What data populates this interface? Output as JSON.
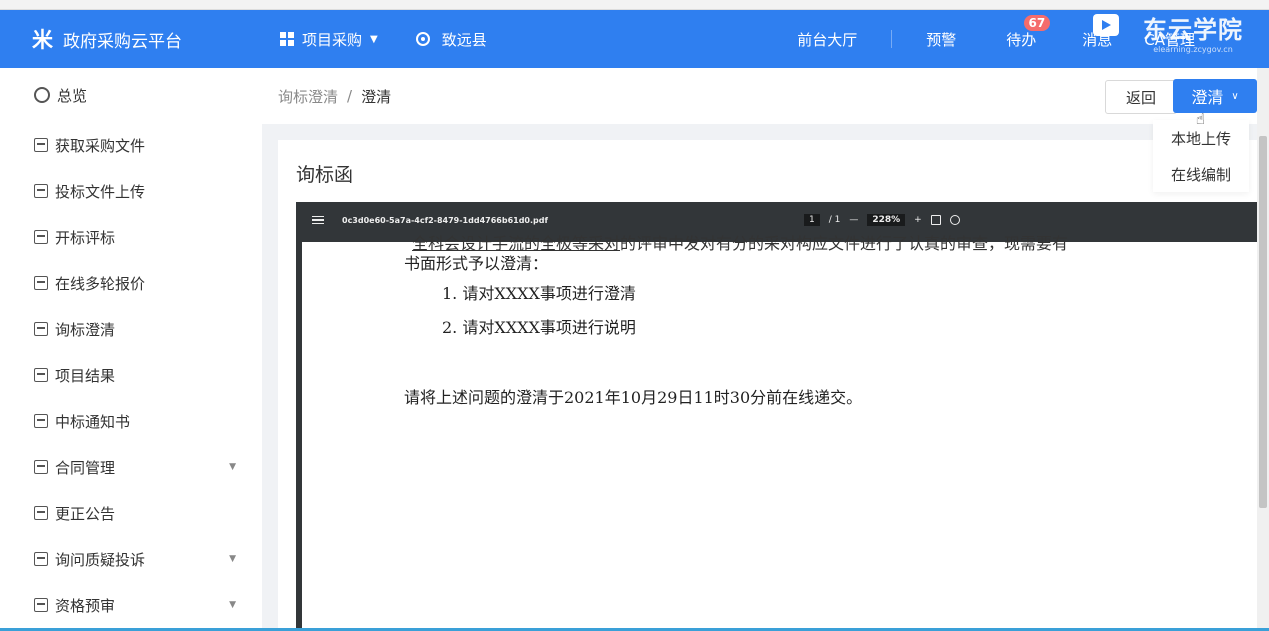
{
  "header": {
    "brand_logo": "米",
    "brand_title": "政府采购云平台",
    "menu_procurement": "项目采购",
    "menu_region": "致远县",
    "link_hall": "前台大厅",
    "link_warning": "预警",
    "link_todo": "待办",
    "todo_count": "67",
    "link_message": "消息",
    "link_ca": "CA管理",
    "watermark_title": "东云学院",
    "watermark_sub": "elearning.zcygov.cn"
  },
  "sidebar": {
    "items": [
      {
        "label": "总览"
      },
      {
        "label": "获取采购文件"
      },
      {
        "label": "投标文件上传"
      },
      {
        "label": "开标评标"
      },
      {
        "label": "在线多轮报价"
      },
      {
        "label": "询标澄清"
      },
      {
        "label": "项目结果"
      },
      {
        "label": "中标通知书"
      },
      {
        "label": "合同管理"
      },
      {
        "label": "更正公告"
      },
      {
        "label": "询问质疑投诉"
      },
      {
        "label": "资格预审"
      }
    ]
  },
  "breadcrumb": {
    "parent": "询标澄清",
    "separator": "/",
    "current": "澄清"
  },
  "actions": {
    "back_label": "返回",
    "clarify_label": "澄清",
    "dropdown": [
      "本地上传",
      "在线编制"
    ]
  },
  "card": {
    "title": "询标函"
  },
  "pdf": {
    "filename": "0c3d0e60-5a7a-4cf2-8479-1dd4766b61d0.pdf",
    "page_current": "1",
    "page_total": "/ 1",
    "zoom_minus": "—",
    "zoom": "228%",
    "zoom_plus": "+",
    "lines": {
      "cut_top_a": "    全科会设计手流的全极等采对",
      "cut_top_b": "的评审中发对有分的采对构应文件进行了认真的审查，现需要有",
      "line1": "书面形式予以澄清：",
      "item1": "1. 请对XXXX事项进行澄清",
      "item2": "2. 请对XXXX事项进行说明",
      "deadline": "请将上述问题的澄清于2021年10月29日11时30分前在线递交。"
    }
  },
  "colors": {
    "primary": "#2f7ff0",
    "badge": "#f56c6c",
    "pdf_toolbar": "#323639"
  }
}
